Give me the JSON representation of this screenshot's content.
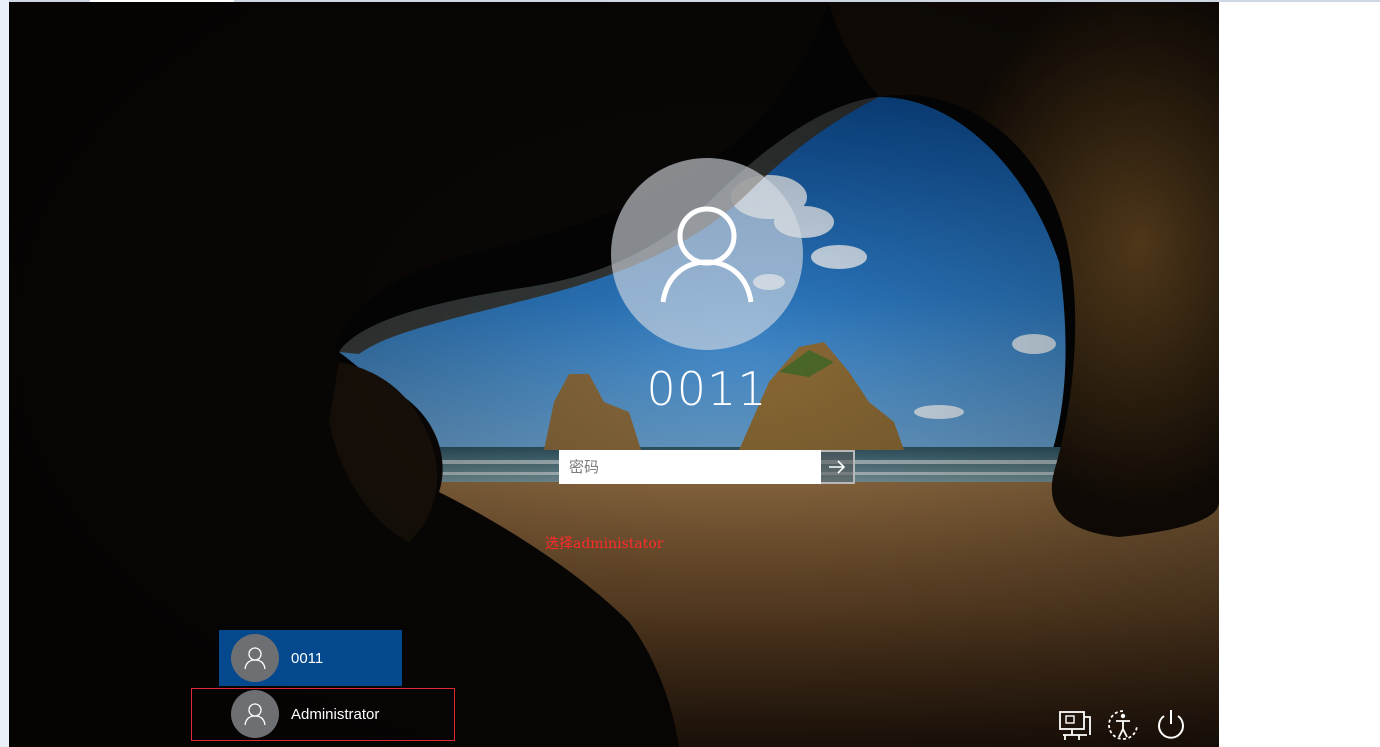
{
  "window": {
    "accent_colors": {
      "selected_tile": "#04498d",
      "annotation": "#ff2b2b"
    }
  },
  "lock_screen": {
    "username": "0011",
    "password_field": {
      "value": "",
      "placeholder": "密码"
    },
    "submit_icon": "arrow-right-icon",
    "annotation": "选择administator",
    "users": [
      {
        "label": "0011",
        "icon": "user-icon",
        "selected": true
      },
      {
        "label": "Administrator",
        "icon": "user-icon",
        "selected": false
      }
    ],
    "system_icons": [
      "network-icon",
      "ease-of-access-icon",
      "power-icon"
    ]
  }
}
